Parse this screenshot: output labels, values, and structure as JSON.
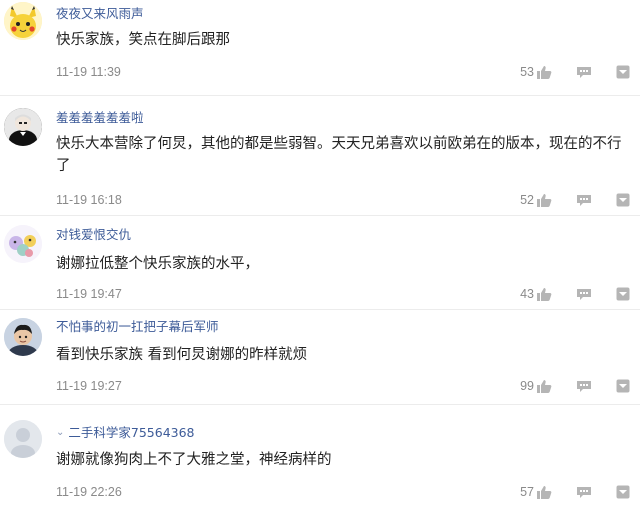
{
  "comments": [
    {
      "username": "夜夜又来风雨声",
      "content": "快乐家族，笑点在脚后跟那",
      "time": "11-19 11:39",
      "likes": "53"
    },
    {
      "username": "羞羞羞羞羞羞啦",
      "content": "快乐大本营除了何炅，其他的都是些弱智。天天兄弟喜欢以前欧弟在的版本，现在的不行了",
      "time": "11-19 16:18",
      "likes": "52"
    },
    {
      "username": "对钱爱恨交仇",
      "content": "谢娜拉低整个快乐家族的水平，",
      "time": "11-19 19:47",
      "likes": "43"
    },
    {
      "username": "不怕事的初一扛把子幕后军师",
      "content": "看到快乐家族 看到何炅谢娜的昨样就烦",
      "time": "11-19 19:27",
      "likes": "99"
    },
    {
      "username": "二手科学家75564368",
      "content": "谢娜就像狗肉上不了大雅之堂，神经病样的",
      "time": "11-19 22:26",
      "likes": "57"
    }
  ],
  "icons": {
    "like": "thumbs-up-icon",
    "reply": "reply-icon",
    "more": "more-icon"
  },
  "colors": {
    "username": "#3d5b98",
    "content": "#222222",
    "meta": "#8a8a8a",
    "icon": "#b5b5b5"
  }
}
